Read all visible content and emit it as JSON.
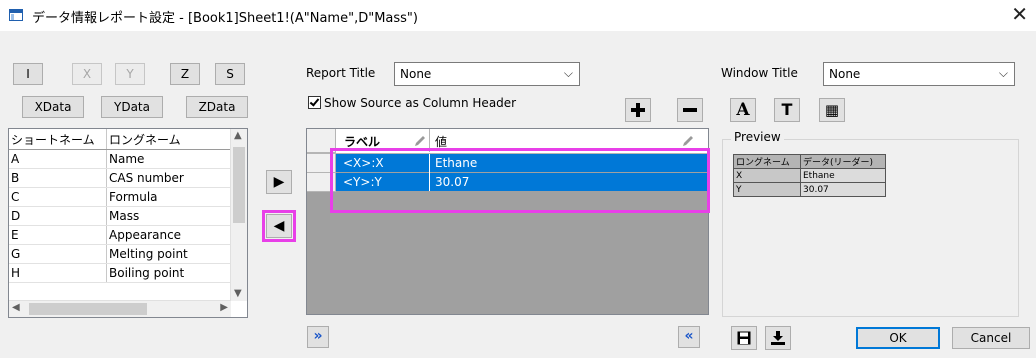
{
  "title_bar": {
    "title": "データ情報レポート設定 - [Book1]Sheet1!(A\"Name\",D\"Mass\")",
    "close_glyph": "✕"
  },
  "axis_buttons": [
    {
      "label": "I",
      "enabled": true
    },
    {
      "label": "X",
      "enabled": false
    },
    {
      "label": "Y",
      "enabled": false
    },
    {
      "label": "Z",
      "enabled": true
    },
    {
      "label": "S",
      "enabled": true
    }
  ],
  "data_buttons": [
    {
      "label": "XData"
    },
    {
      "label": "YData"
    },
    {
      "label": "ZData"
    }
  ],
  "column_list": {
    "headers": [
      "ショートネーム",
      "ロングネーム"
    ],
    "rows": [
      [
        "A",
        "Name"
      ],
      [
        "B",
        "CAS number"
      ],
      [
        "C",
        "Formula"
      ],
      [
        "D",
        "Mass"
      ],
      [
        "E",
        "Appearance"
      ],
      [
        "G",
        "Melting point"
      ],
      [
        "H",
        "Boiling point"
      ]
    ]
  },
  "transfer": {
    "add_glyph": "▶",
    "remove_glyph": "◀"
  },
  "report_title": {
    "label": "Report Title",
    "value": "None"
  },
  "show_source": {
    "label": "Show Source as Column Header",
    "checked": true
  },
  "report_grid": {
    "headers": [
      "ラベル",
      "値"
    ],
    "rows": [
      {
        "label": "<X>:X",
        "value": "Ethane"
      },
      {
        "label": "<Y>:Y",
        "value": "30.07"
      }
    ]
  },
  "window_title": {
    "label": "Window Title",
    "value": "None"
  },
  "style_icons": {
    "font_glyph": "A",
    "text_glyph": "T",
    "table_glyph": "▦"
  },
  "preview": {
    "label": "Preview",
    "headers": [
      "ロングネーム",
      "データ(リーダー)"
    ],
    "rows": [
      [
        "X",
        "Ethane"
      ],
      [
        "Y",
        "30.07"
      ]
    ]
  },
  "footer": {
    "expand_glyph": "»",
    "collapse_glyph": "«",
    "ok": "OK",
    "cancel": "Cancel"
  },
  "colors": {
    "selection": "#0078d7",
    "highlight_frame": "#e83fe8",
    "grid_gray": "#a0a0a0"
  }
}
